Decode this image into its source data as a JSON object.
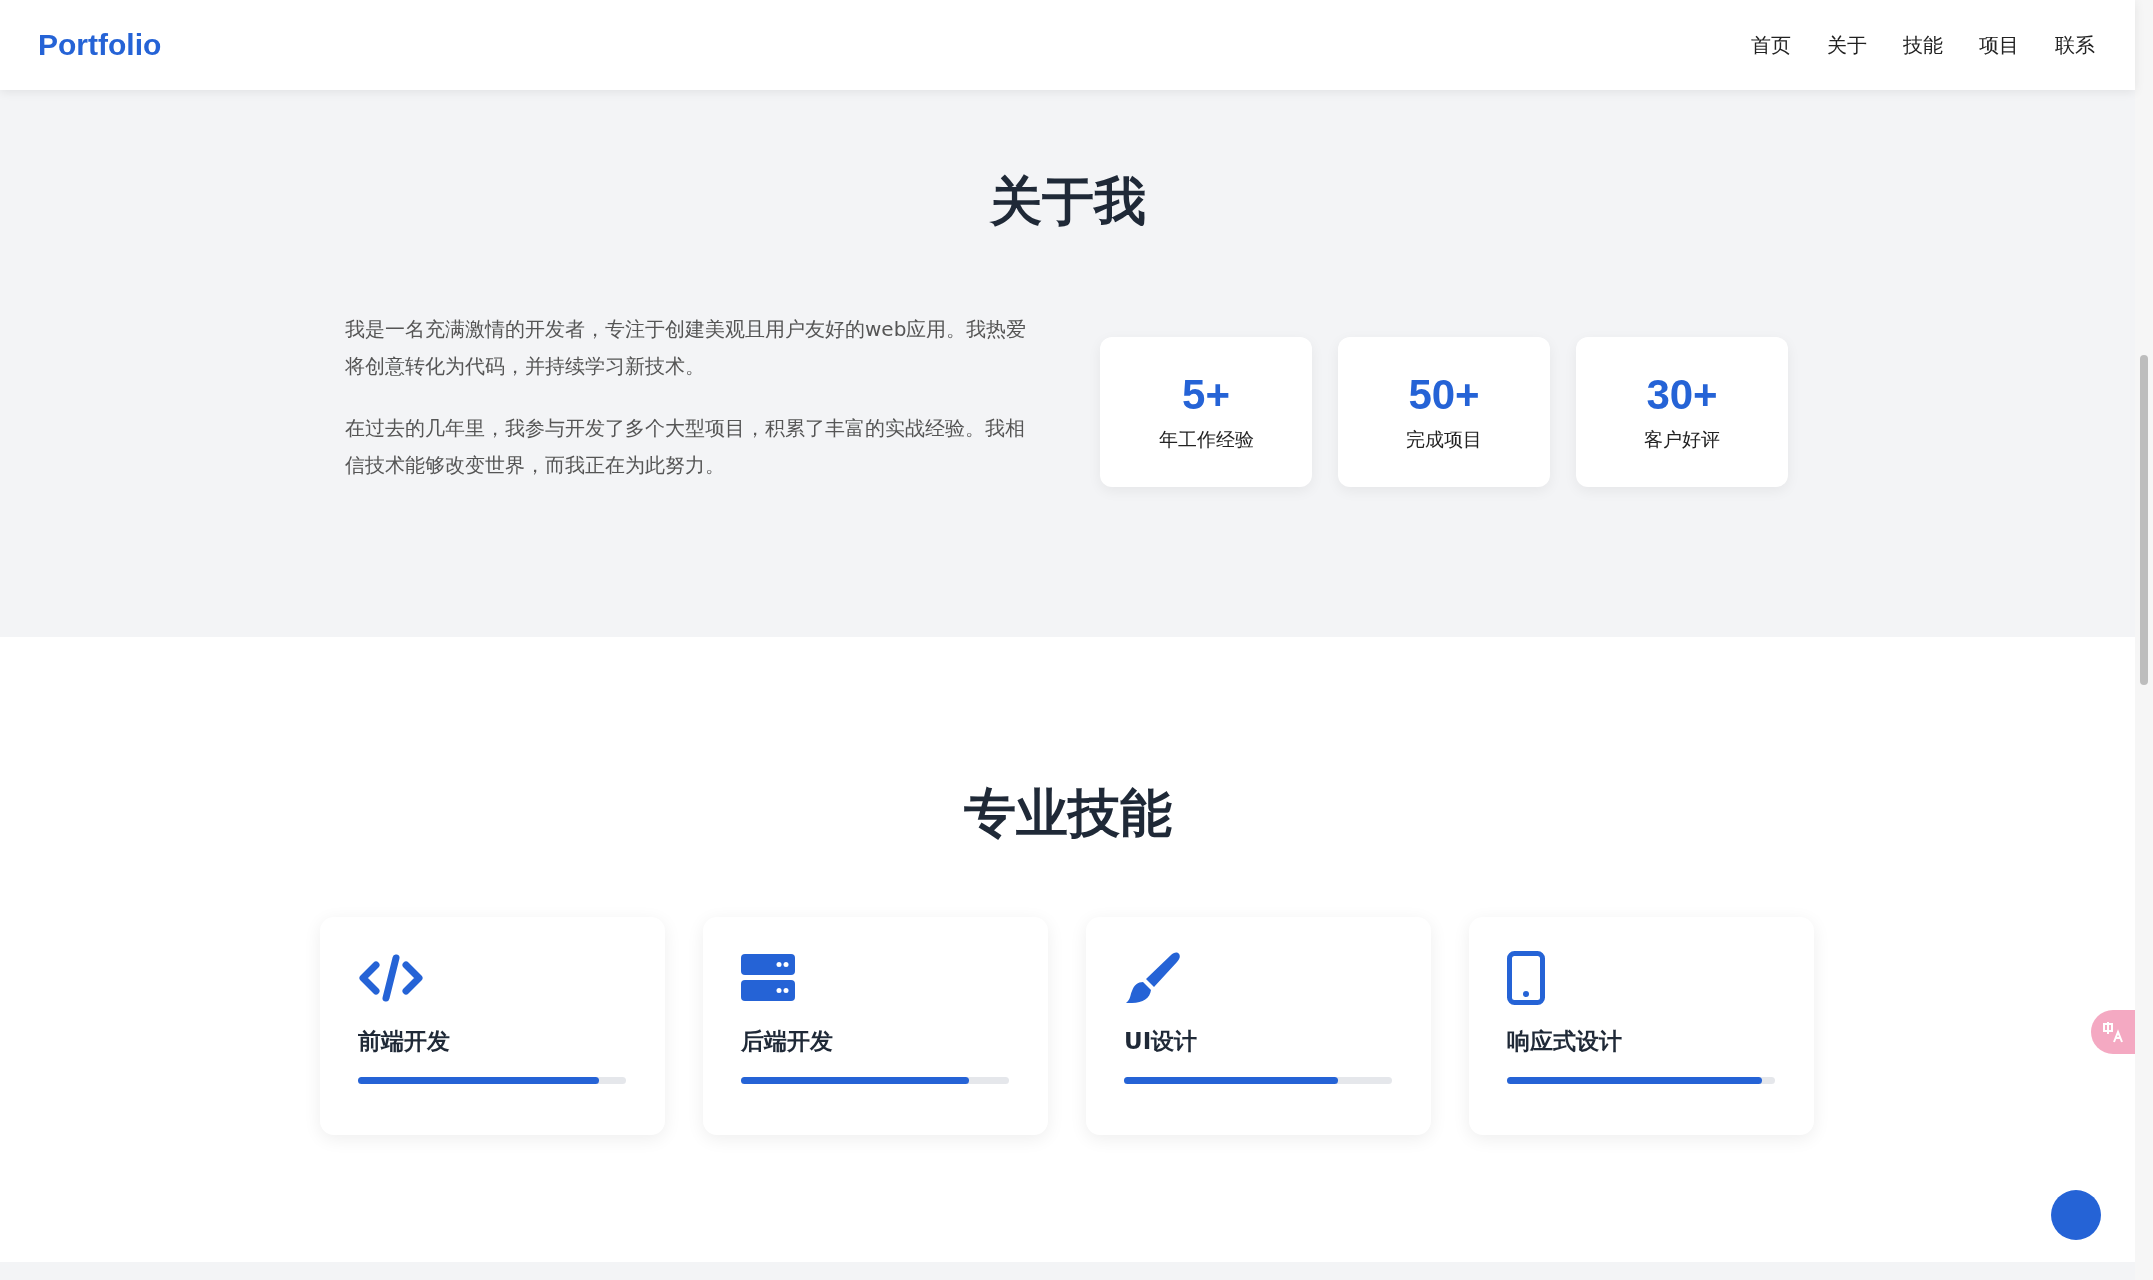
{
  "header": {
    "logo": "Portfolio",
    "nav": [
      {
        "label": "首页"
      },
      {
        "label": "关于"
      },
      {
        "label": "技能"
      },
      {
        "label": "项目"
      },
      {
        "label": "联系"
      }
    ]
  },
  "about": {
    "title": "关于我",
    "paragraphs": [
      "我是一名充满激情的开发者，专注于创建美观且用户友好的web应用。我热爱将创意转化为代码，并持续学习新技术。",
      "在过去的几年里，我参与开发了多个大型项目，积累了丰富的实战经验。我相信技术能够改变世界，而我正在为此努力。"
    ],
    "stats": [
      {
        "value": "5+",
        "label": "年工作经验"
      },
      {
        "value": "50+",
        "label": "完成项目"
      },
      {
        "value": "30+",
        "label": "客户好评"
      }
    ]
  },
  "skills": {
    "title": "专业技能",
    "items": [
      {
        "kind": "code",
        "name": "前端开发",
        "level": 0.9
      },
      {
        "kind": "server",
        "name": "后端开发",
        "level": 0.85
      },
      {
        "kind": "brush",
        "name": "UI设计",
        "level": 0.8
      },
      {
        "kind": "mobile",
        "name": "响应式设计",
        "level": 0.95
      }
    ]
  }
}
